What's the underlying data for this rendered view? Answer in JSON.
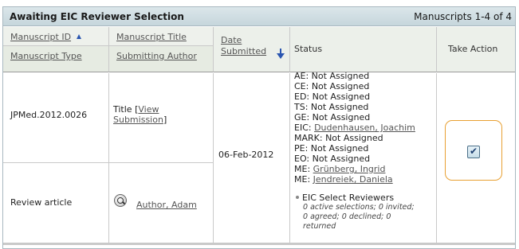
{
  "panel": {
    "title": "Awaiting EIC Reviewer Selection",
    "count": "Manuscripts 1-4 of 4"
  },
  "columns": {
    "manuscript_id": "Manuscript ID",
    "manuscript_type": "Manuscript Type",
    "manuscript_title": "Manuscript Title",
    "submitting_author": "Submitting Author",
    "date_submitted_1": "Date",
    "date_submitted_2": "Submitted",
    "status": "Status",
    "take_action": "Take Action"
  },
  "row": {
    "id": "JPMed.2012.0026",
    "type": "Review article",
    "title_prefix": "Title [",
    "view_1": "View",
    "view_2": "Submission",
    "title_suffix": "]",
    "author": "Author, Adam",
    "date": "06-Feb-2012",
    "status": {
      "ae": "AE: Not Assigned",
      "ce": "CE: Not Assigned",
      "ed": "ED: Not Assigned",
      "ts": "TS: Not Assigned",
      "ge": "GE: Not Assigned",
      "eic_label": "EIC: ",
      "eic_name": "Dudenhausen, Joachim",
      "mark": "MARK: Not Assigned",
      "pe": "PE: Not Assigned",
      "eo": "EO: Not Assigned",
      "me1_label": "ME: ",
      "me1_name": "Grünberg, Ingrid",
      "me2_label": "ME: ",
      "me2_name": "Jendreiek, Daniela",
      "select_reviewers": "EIC Select Reviewers",
      "counts_1": "0 active selections; 0 invited;",
      "counts_2": "0 agreed; 0 declined; 0",
      "counts_3": "returned"
    },
    "action_checked": true
  },
  "icons": {
    "sort_id": "sort-ascending-icon",
    "sort_date": "sort-descending-icon",
    "author_lookup": "magnifier-icon",
    "take_action": "checkbox-checked-icon"
  },
  "colors": {
    "title_bar": "#c6d6dc",
    "header_bg": "#ecf0ea",
    "sort_arrow": "#2a55b0",
    "action_border": "#e8a032",
    "link": "#555555"
  }
}
